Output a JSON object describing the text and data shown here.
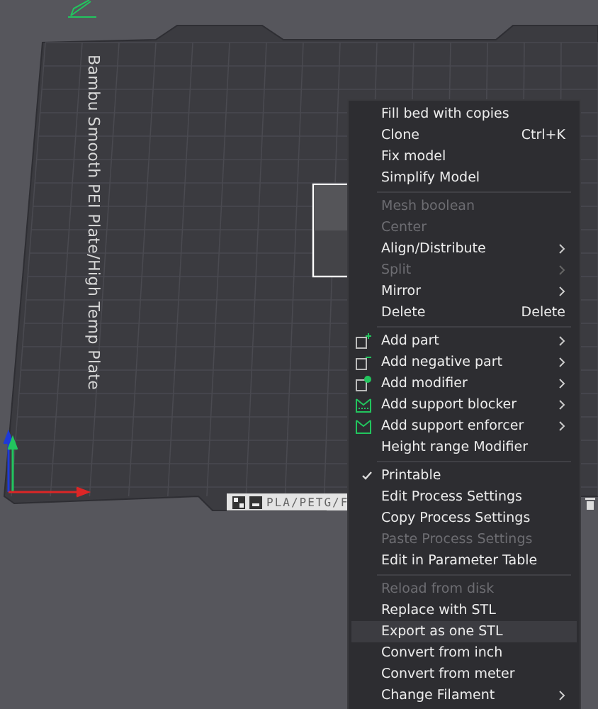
{
  "plate": {
    "label": "Bambu Smooth PEI Plate/High Temp Plate",
    "filament_tag": "PLA/PETG/F"
  },
  "context_menu": [
    {
      "kind": "item",
      "label": "Fill bed with copies",
      "disabled": false,
      "submenu": false,
      "selected": false
    },
    {
      "kind": "item",
      "label": "Clone",
      "shortcut": "Ctrl+K",
      "disabled": false,
      "submenu": false,
      "selected": false
    },
    {
      "kind": "item",
      "label": "Fix model",
      "disabled": false,
      "submenu": false,
      "selected": false
    },
    {
      "kind": "item",
      "label": "Simplify Model",
      "disabled": false,
      "submenu": false,
      "selected": false
    },
    {
      "kind": "separator"
    },
    {
      "kind": "item",
      "label": "Mesh boolean",
      "disabled": true,
      "submenu": false,
      "selected": false
    },
    {
      "kind": "item",
      "label": "Center",
      "disabled": true,
      "submenu": false,
      "selected": false
    },
    {
      "kind": "item",
      "label": "Align/Distribute",
      "disabled": false,
      "submenu": true,
      "selected": false
    },
    {
      "kind": "item",
      "label": "Split",
      "disabled": true,
      "submenu": true,
      "selected": false
    },
    {
      "kind": "item",
      "label": "Mirror",
      "disabled": false,
      "submenu": true,
      "selected": false
    },
    {
      "kind": "item",
      "label": "Delete",
      "shortcut": "Delete",
      "disabled": false,
      "submenu": false,
      "selected": false
    },
    {
      "kind": "separator"
    },
    {
      "kind": "part",
      "label": "Add part",
      "disabled": false,
      "submenu": true,
      "selected": false
    },
    {
      "kind": "negative",
      "label": "Add negative part",
      "disabled": false,
      "submenu": true,
      "selected": false
    },
    {
      "kind": "modifier",
      "label": "Add modifier",
      "disabled": false,
      "submenu": true,
      "selected": false
    },
    {
      "kind": "blocker",
      "label": "Add support blocker",
      "disabled": false,
      "submenu": true,
      "selected": false
    },
    {
      "kind": "enforcer",
      "label": "Add support enforcer",
      "disabled": false,
      "submenu": true,
      "selected": false
    },
    {
      "kind": "item",
      "label": "Height range Modifier",
      "disabled": false,
      "submenu": false,
      "selected": false
    },
    {
      "kind": "separator"
    },
    {
      "kind": "item",
      "label": "Printable",
      "checked": true,
      "disabled": false,
      "submenu": false,
      "selected": false
    },
    {
      "kind": "item",
      "label": "Edit Process Settings",
      "disabled": false,
      "submenu": false,
      "selected": false
    },
    {
      "kind": "item",
      "label": "Copy Process Settings",
      "disabled": false,
      "submenu": false,
      "selected": false
    },
    {
      "kind": "item",
      "label": "Paste Process Settings",
      "disabled": true,
      "submenu": false,
      "selected": false
    },
    {
      "kind": "item",
      "label": "Edit in Parameter Table",
      "disabled": false,
      "submenu": false,
      "selected": false
    },
    {
      "kind": "separator"
    },
    {
      "kind": "item",
      "label": "Reload from disk",
      "disabled": true,
      "submenu": false,
      "selected": false
    },
    {
      "kind": "item",
      "label": "Replace with STL",
      "disabled": false,
      "submenu": false,
      "selected": false
    },
    {
      "kind": "item",
      "label": "Export as one STL",
      "disabled": false,
      "submenu": false,
      "selected": true
    },
    {
      "kind": "item",
      "label": "Convert from inch",
      "disabled": false,
      "submenu": false,
      "selected": false
    },
    {
      "kind": "item",
      "label": "Convert from meter",
      "disabled": false,
      "submenu": false,
      "selected": false
    },
    {
      "kind": "item",
      "label": "Change Filament",
      "disabled": false,
      "submenu": true,
      "selected": false
    }
  ]
}
